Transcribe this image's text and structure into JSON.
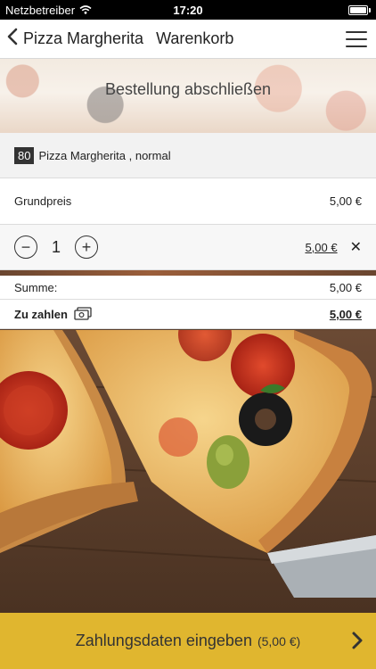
{
  "status_bar": {
    "carrier": "Netzbetreiber",
    "time": "17:20",
    "battery_level": 1.0
  },
  "nav": {
    "title": "Pizza Margherita",
    "subtitle": "Warenkorb",
    "icons": {
      "back": "chevron-left-icon",
      "menu": "hamburger-menu-icon"
    }
  },
  "banner": {
    "title": "Bestellung abschließen"
  },
  "item": {
    "number": "80",
    "name": "Pizza Margherita , normal",
    "base_price_label": "Grundpreis",
    "base_price": "5,00 €",
    "quantity": "1",
    "decrement_symbol": "−",
    "increment_symbol": "+",
    "line_total": "5,00 €",
    "remove_symbol": "✕"
  },
  "summary": {
    "sum_label": "Summe:",
    "sum_value": "5,00 €",
    "pay_label": "Zu zahlen",
    "pay_value": "5,00 €"
  },
  "footer": {
    "label": "Zahlungsdaten eingeben",
    "amount": "(5,00 €)"
  },
  "colors": {
    "accent": "#e0b62f",
    "dark": "#333333"
  }
}
